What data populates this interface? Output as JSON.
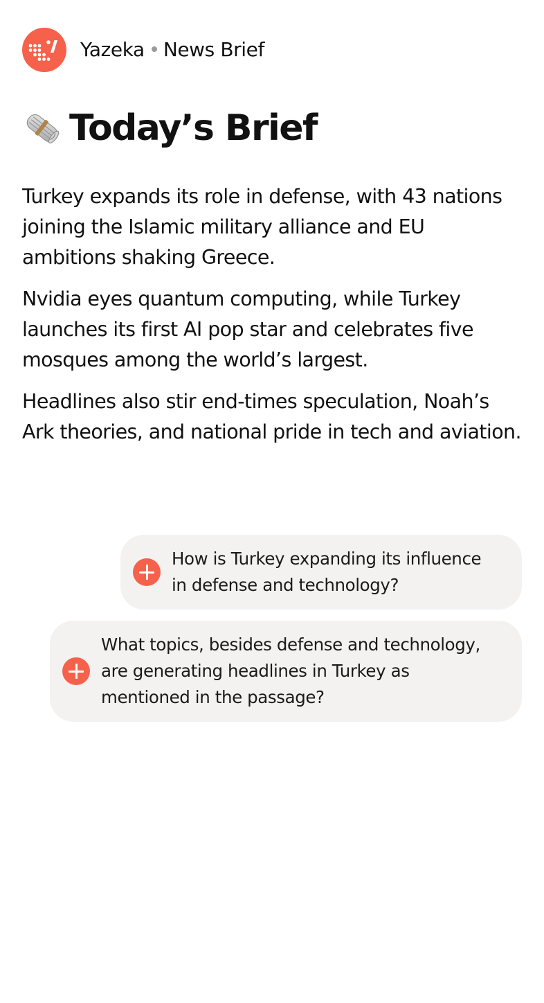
{
  "header": {
    "app_name": "Yazeka",
    "section": "News Brief",
    "logo_icon": "yazeka-logo-icon",
    "accent_color": "#f5614b"
  },
  "brief": {
    "icon": "newspaper-icon",
    "title": "Today’s Brief",
    "paragraphs": [
      "Turkey expands its role in defense, with 43 nations joining the Islamic military alliance and EU ambitions shaking Greece.",
      "Nvidia eyes quantum computing, while Turkey launches its first AI pop star and celebrates five mosques among the world’s largest.",
      "Headlines also stir end-times speculation, Noah’s Ark theories, and national pride in tech and aviation."
    ]
  },
  "questions": [
    {
      "icon": "plus-icon",
      "text": "How is Turkey expanding its influence in defense and technology?"
    },
    {
      "icon": "plus-icon",
      "text": "What topics, besides defense and technology, are generating headlines in Turkey as mentioned in the passage?"
    }
  ]
}
